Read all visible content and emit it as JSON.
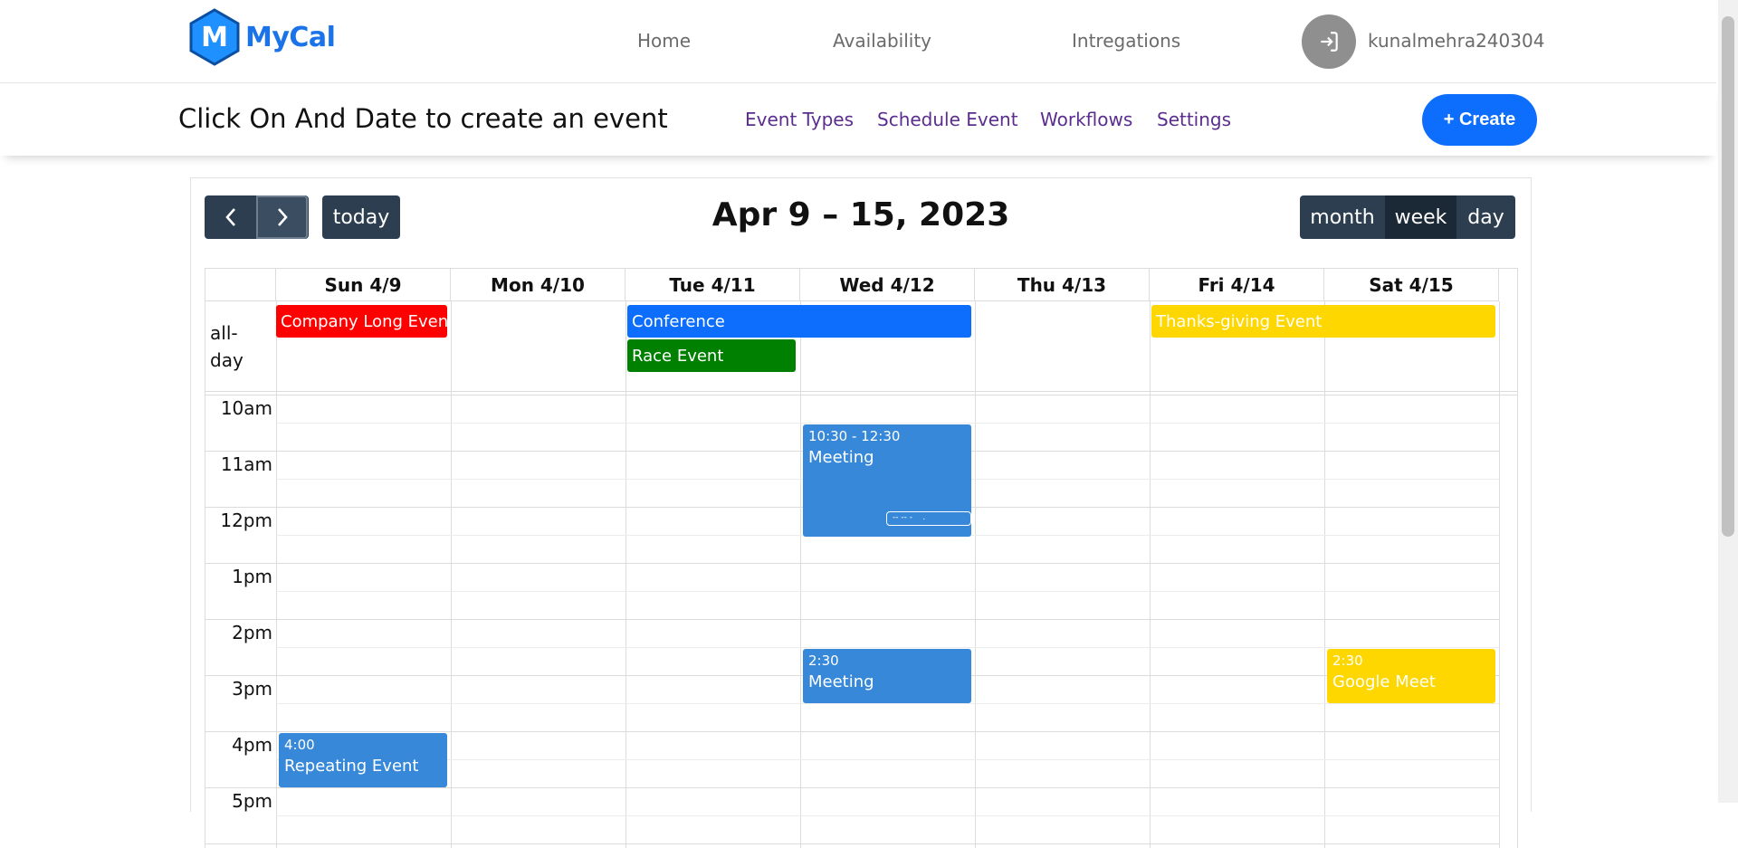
{
  "brand": {
    "name": "MyCal",
    "letter": "M"
  },
  "nav": {
    "home": "Home",
    "availability": "Availability",
    "integrations": "Intregations",
    "username": "kunalmehra240304"
  },
  "subbar": {
    "title": "Click On And Date to create an event",
    "links": [
      "Event Types",
      "Schedule Event",
      "Workflows",
      "Settings"
    ],
    "create": "+ Create"
  },
  "toolbar": {
    "today": "today",
    "title": "Apr 9 – 15, 2023",
    "views": [
      "month",
      "week",
      "day"
    ],
    "active_view": "week"
  },
  "days": [
    "Sun 4/9",
    "Mon 4/10",
    "Tue 4/11",
    "Wed 4/12",
    "Thu 4/13",
    "Fri 4/14",
    "Sat 4/15"
  ],
  "allday_label": "all-day",
  "times": [
    "10am",
    "11am",
    "12pm",
    "1pm",
    "2pm",
    "3pm",
    "4pm",
    "5pm"
  ],
  "allday_events": [
    {
      "title": "Company Long Event",
      "color": "#ff0000"
    },
    {
      "title": "Conference",
      "color": "#0d6efd"
    },
    {
      "title": "Race Event",
      "color": "#008000"
    },
    {
      "title": "Thanks-giving Event",
      "color": "#ffd700"
    }
  ],
  "timed_events": [
    {
      "time": "10:30 - 12:30",
      "title": "Meeting",
      "color": "#3788d8"
    },
    {
      "time": "2:30",
      "title": "Meeting",
      "color": "#3788d8"
    },
    {
      "time": "2:30",
      "title": "Google Meet",
      "color": "#ffd700"
    },
    {
      "time": "4:00",
      "title": "Repeating Event",
      "color": "#3788d8"
    }
  ],
  "icons": {
    "logo": "hexagon-logo-icon",
    "avatar": "login-icon",
    "prev": "chevron-left-icon",
    "next": "chevron-right-icon"
  }
}
